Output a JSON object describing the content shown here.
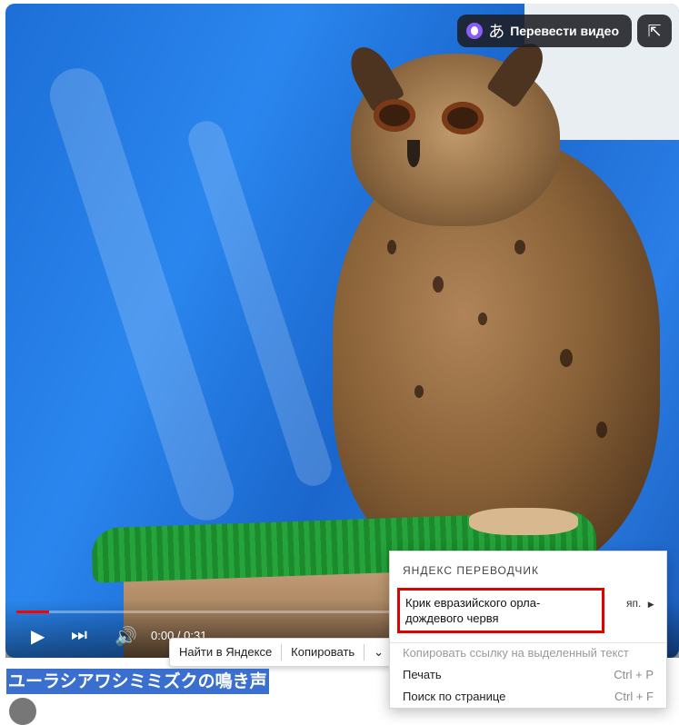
{
  "video": {
    "translate_button_label": "Перевести видео",
    "translate_glyph": "あ",
    "time_display": "0:00 / 0:31",
    "progress_fraction": 0.05,
    "accent_progress_color": "#ff0000"
  },
  "selection_toolbar": {
    "find_label": "Найти в Яндексе",
    "copy_label": "Копировать"
  },
  "page": {
    "selected_title": "ユーラシアワシミミズクの鳴き声"
  },
  "context_menu": {
    "header": "ЯНДЕКС ПЕРЕВОДЧИК",
    "translation": "Крик евразийского орла-дождевого червя",
    "language": "яп.",
    "items": [
      {
        "label": "Копировать ссылку на выделенный текст",
        "shortcut": "",
        "disabled": true
      },
      {
        "label": "Печать",
        "shortcut": "Ctrl + P",
        "disabled": false
      },
      {
        "label": "Поиск по странице",
        "shortcut": "Ctrl + F",
        "disabled": false
      }
    ]
  }
}
